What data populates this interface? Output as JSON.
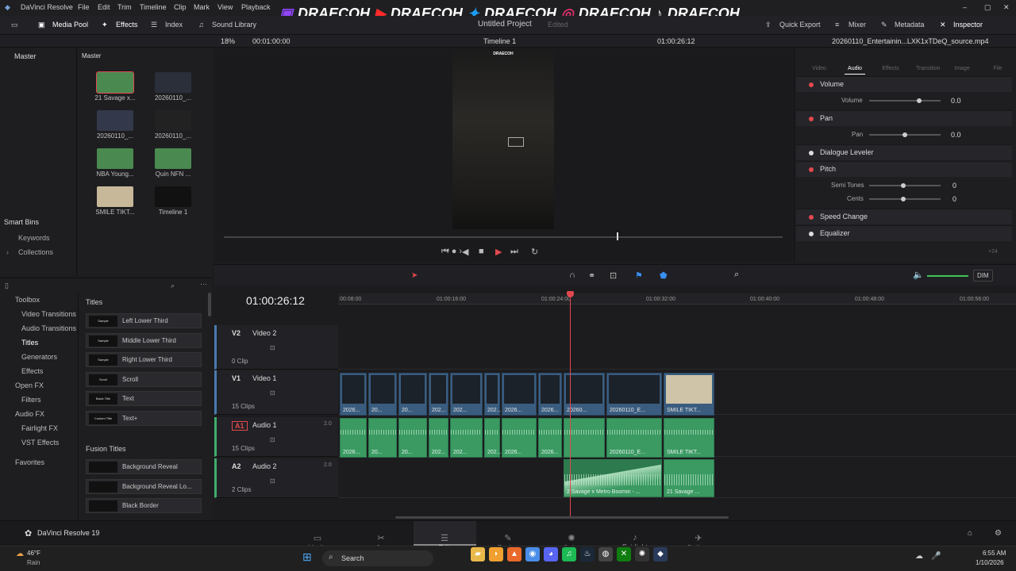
{
  "app": {
    "name": "DaVinci Resolve"
  },
  "menu": [
    "File",
    "Edit",
    "Trim",
    "Timeline",
    "Clip",
    "Mark",
    "View",
    "Playback"
  ],
  "overlay": {
    "handle": "DRAECOH"
  },
  "window": {
    "project_title": "Untitled Project",
    "edited_label": "Edited"
  },
  "toolbar": {
    "left": [
      "Media Pool",
      "Effects",
      "Index",
      "Sound Library"
    ],
    "right": [
      "Quick Export",
      "Mixer",
      "Metadata",
      "Inspector"
    ]
  },
  "viewer": {
    "zoom": "18%",
    "src_timecode": "00:01:00:00",
    "timeline_name": "Timeline 1",
    "rec_timecode": "01:00:26:12",
    "filename": "20260110_Entertainin...LXK1xTDeQ_source.mp4"
  },
  "media_pool": {
    "root": "Master",
    "bin_header": "Master",
    "clips": [
      {
        "label": "21 Savage x...",
        "color": "#4a8a50"
      },
      {
        "label": "20260110_...",
        "color": "#2a2f3a"
      },
      {
        "label": "20260110_...",
        "color": "#33384a"
      },
      {
        "label": "20260110_...",
        "color": "#222"
      },
      {
        "label": "NBA Young...",
        "color": "#4a8a50"
      },
      {
        "label": "Quin NFN ...",
        "color": "#4a8a50"
      },
      {
        "label": "SMILE TIKT...",
        "color": "#c8b89a"
      },
      {
        "label": "Timeline 1",
        "color": "#111"
      }
    ],
    "smart_bins": "Smart Bins",
    "smart_items": [
      "Keywords",
      "Collections"
    ]
  },
  "effects_library": {
    "toolbox_items": [
      "Toolbox",
      "Video Transitions",
      "Audio Transitions",
      "Titles",
      "Generators",
      "Effects",
      "Open FX",
      "Filters",
      "Audio FX",
      "Fairlight FX",
      "VST Effects",
      "Favorites"
    ],
    "titles_header": "Titles",
    "titles": [
      {
        "thumb": "Sample",
        "label": "Left Lower Third"
      },
      {
        "thumb": "Sample",
        "label": "Middle Lower Third"
      },
      {
        "thumb": "Sample",
        "label": "Right Lower Third"
      },
      {
        "thumb": "Scroll",
        "label": "Scroll"
      },
      {
        "thumb": "Basic Title",
        "label": "Text"
      },
      {
        "thumb": "Custom Title",
        "label": "Text+"
      }
    ],
    "fusion_header": "Fusion Titles",
    "fusion": [
      {
        "thumb": "",
        "label": "Background Reveal"
      },
      {
        "thumb": "",
        "label": "Background Reveal Lo..."
      },
      {
        "thumb": "",
        "label": "Black Border"
      }
    ]
  },
  "inspector": {
    "tabs": [
      "Video",
      "Audio",
      "Effects",
      "Transition",
      "Image",
      "File"
    ],
    "active_tab": "Audio",
    "volume": {
      "label": "Volume",
      "sub": "Volume",
      "value": "0.0",
      "level": 0.7
    },
    "pan": {
      "label": "Pan",
      "sub": "Pan",
      "value": "0.0",
      "level": 0.5
    },
    "dialogue": "Dialogue Leveler",
    "pitch": {
      "label": "Pitch",
      "semi": "Semi Tones",
      "semi_val": "0",
      "cents": "Cents",
      "cents_val": "0"
    },
    "speed": "Speed Change",
    "eq": "Equalizer",
    "eq_value": "+24"
  },
  "timeline": {
    "timecode": "01:00:26:12",
    "ruler": [
      "00:08:00",
      "01:00:16:00",
      "01:00:24:00",
      "01:00:32:00",
      "01:00:40:00",
      "01:00:48:00",
      "01:00:56:00"
    ],
    "zoom_value": "DIM",
    "tracks": [
      {
        "id": "V2",
        "name": "Video 2",
        "count": "0 Clip"
      },
      {
        "id": "V1",
        "name": "Video 1",
        "count": "15 Clips"
      },
      {
        "id": "A1",
        "name": "Audio 1",
        "count": "15 Clips",
        "ch": "2.0"
      },
      {
        "id": "A2",
        "name": "Audio 2",
        "count": "2 Clips",
        "ch": "2.0"
      }
    ],
    "v1_clips": [
      "2026...",
      "20...",
      "20...",
      "202...",
      "202...",
      "202...",
      "2026...",
      "2026...",
      "20260...",
      "20260110_E...",
      "SMILE TIKT..."
    ],
    "a1_clips": [
      "2026...",
      "20...",
      "20...",
      "202...",
      "202...",
      "202...",
      "2026...",
      "2026...",
      "",
      "20260110_E...",
      "SMILE TIKT..."
    ],
    "a2_clips": [
      "2 Savage x Metro Boomin - ...",
      "21 Savage ..."
    ]
  },
  "bottom": {
    "brand": "DaVinci Resolve 19",
    "pages": [
      "Media",
      "Cut",
      "Edit",
      "Fusion",
      "Color",
      "Fairlight",
      "Deliver"
    ],
    "active": "Edit"
  },
  "taskbar": {
    "temp": "46°F",
    "weather": "Rain",
    "search": "Search",
    "time": "6:55 AM",
    "date": "1/10/2026"
  }
}
